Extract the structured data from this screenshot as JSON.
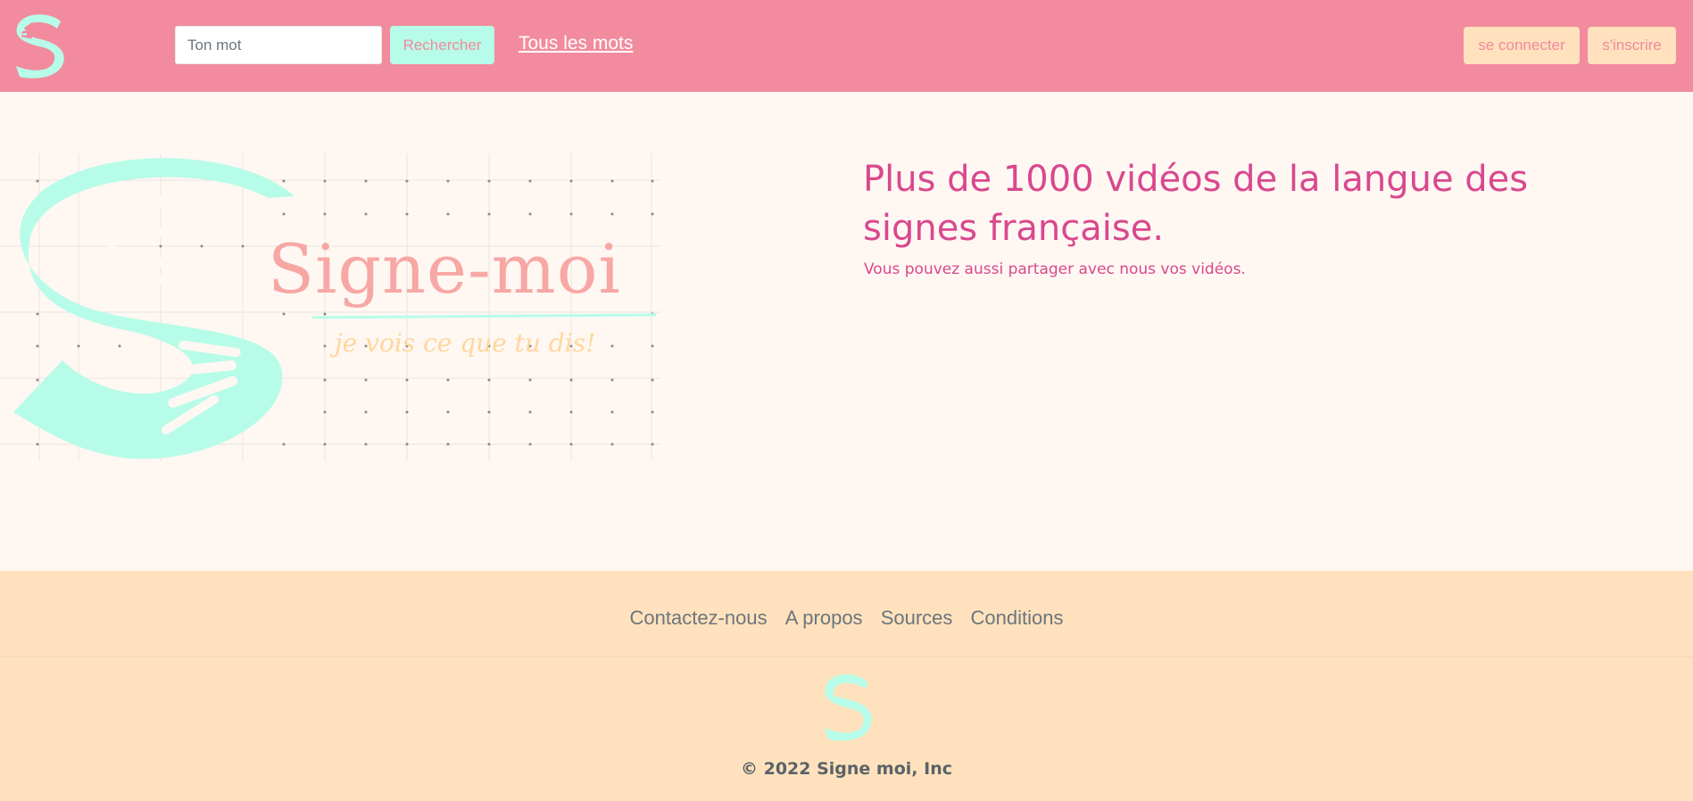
{
  "header": {
    "search_placeholder": "Ton mot",
    "search_button": "Rechercher",
    "all_words_link": "Tous les mots",
    "login_button": "se connecter",
    "signup_button": "s'inscrire"
  },
  "hero": {
    "logo_word": "Signe-moi",
    "logo_tagline": "je vois ce que tu dis!",
    "title": "Plus de 1000 vidéos de la langue des signes française.",
    "subtitle": "Vous pouvez aussi partager avec nous vos vidéos."
  },
  "footer": {
    "links": [
      "Contactez-nous",
      "A propos",
      "Sources",
      "Conditions"
    ],
    "copyright": "© 2022 Signe moi, Inc"
  },
  "colors": {
    "header_bg": "#f28b9e",
    "accent_mint": "#b7fce8",
    "accent_peach": "#ffe1bd",
    "title_pink": "#d9488e",
    "page_bg": "#fff7f2"
  },
  "icons": {
    "brand": "signe-moi-s-logo-icon"
  }
}
